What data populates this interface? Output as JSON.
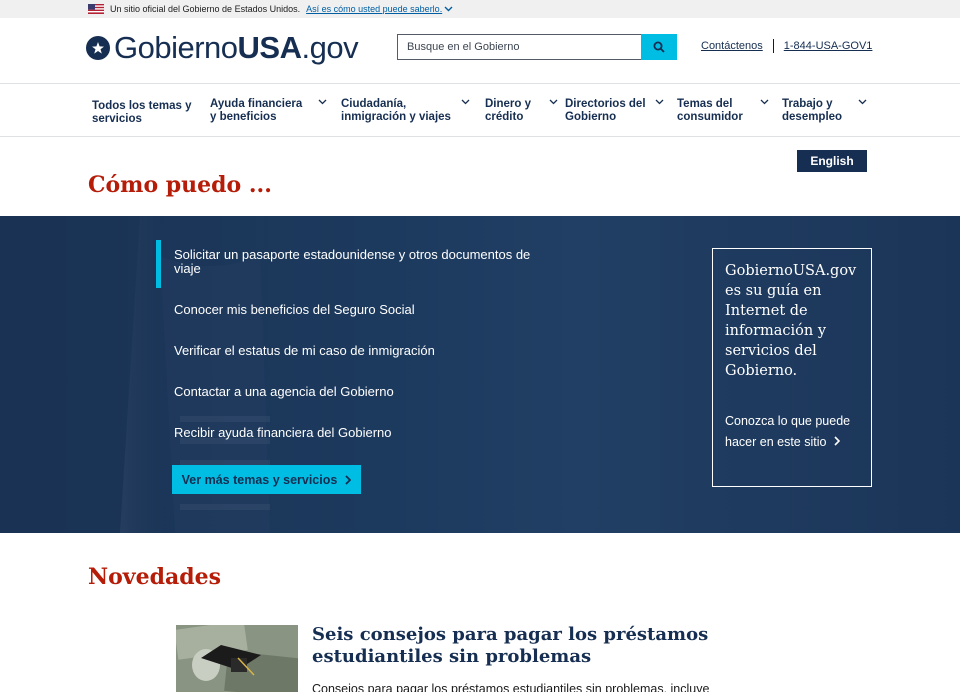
{
  "banner": {
    "official_text": "Un sitio oficial del Gobierno de Estados Unidos.",
    "how_link": "Así es cómo usted puede saberlo."
  },
  "header": {
    "logo_regular": "Gobierno",
    "logo_bold": "USA",
    "logo_suffix": ".gov",
    "search_placeholder": "Busque en el Gobierno",
    "contact_label": "Contáctenos",
    "phone": "1-844-USA-GOV1"
  },
  "nav": {
    "items": [
      {
        "label": "Todos los temas y servicios",
        "has_menu": false
      },
      {
        "label": "Ayuda financiera y beneficios",
        "has_menu": true
      },
      {
        "label": "Ciudadanía, inmigración y viajes",
        "has_menu": true
      },
      {
        "label": "Dinero y crédito",
        "has_menu": true
      },
      {
        "label": "Directorios del Gobierno",
        "has_menu": true
      },
      {
        "label": "Temas del consumidor",
        "has_menu": true
      },
      {
        "label": "Trabajo y desempleo",
        "has_menu": true
      }
    ]
  },
  "language_button": "English",
  "how_do_i": {
    "title": "Cómo puedo ...",
    "links": [
      "Solicitar un pasaporte estadounidense y otros documentos de viaje",
      "Conocer mis beneficios del Seguro Social",
      "Verificar el estatus de mi caso de inmigración",
      "Contactar a una agencia del Gobierno",
      "Recibir ayuda financiera del Gobierno"
    ],
    "more_button": "Ver más temas y servicios",
    "guide_box": {
      "text": "GobiernoUSA.gov es su guía en Internet de información y servicios del Gobierno.",
      "link": "Conozca lo que puede hacer en este sitio"
    }
  },
  "news": {
    "title": "Novedades",
    "article_title": "Seis consejos para pagar los préstamos estudiantiles sin problemas",
    "article_desc": "Consejos para pagar los préstamos estudiantiles sin problemas, incluye"
  },
  "colors": {
    "navy": "#162e51",
    "accent_cyan": "#00bde3",
    "title_red": "#b51d09",
    "hero_bg": "#1c3a5e"
  }
}
